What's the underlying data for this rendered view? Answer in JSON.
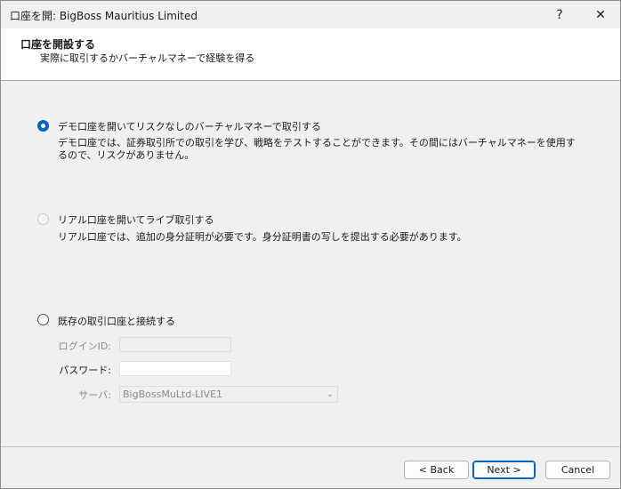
{
  "window": {
    "title": "口座を開: BigBoss Mauritius Limited",
    "help_glyph": "?",
    "close_glyph": "✕"
  },
  "header": {
    "title": "口座を開設する",
    "subtitle": "実際に取引するかバーチャルマネーで経験を得る"
  },
  "options": {
    "demo": {
      "label": "デモ口座を開いてリスクなしのバーチャルマネーで取引する",
      "description": "デモ口座では、証券取引所での取引を学び、戦略をテストすることができます。その間にはバーチャルマネーを使用するので、リスクがありません。",
      "selected": true
    },
    "real": {
      "label": "リアル口座を開いてライブ取引する",
      "description": "リアル口座では、追加の身分証明が必要です。身分証明書の写しを提出する必要があります。",
      "selected": false,
      "enabled": false
    },
    "existing": {
      "label": "既存の取引口座と接続する",
      "selected": false
    }
  },
  "login": {
    "login_label": "ログインID:",
    "login_value": "",
    "password_label": "パスワード:",
    "password_value": "",
    "server_label": "サーバ:",
    "server_value": "BigBossMuLtd-LIVE1"
  },
  "buttons": {
    "back": "< Back",
    "next": "Next >",
    "cancel": "Cancel"
  },
  "colors": {
    "accent": "#0067c0",
    "header_bg": "#ffffff",
    "body_bg": "#f0f0f0"
  }
}
